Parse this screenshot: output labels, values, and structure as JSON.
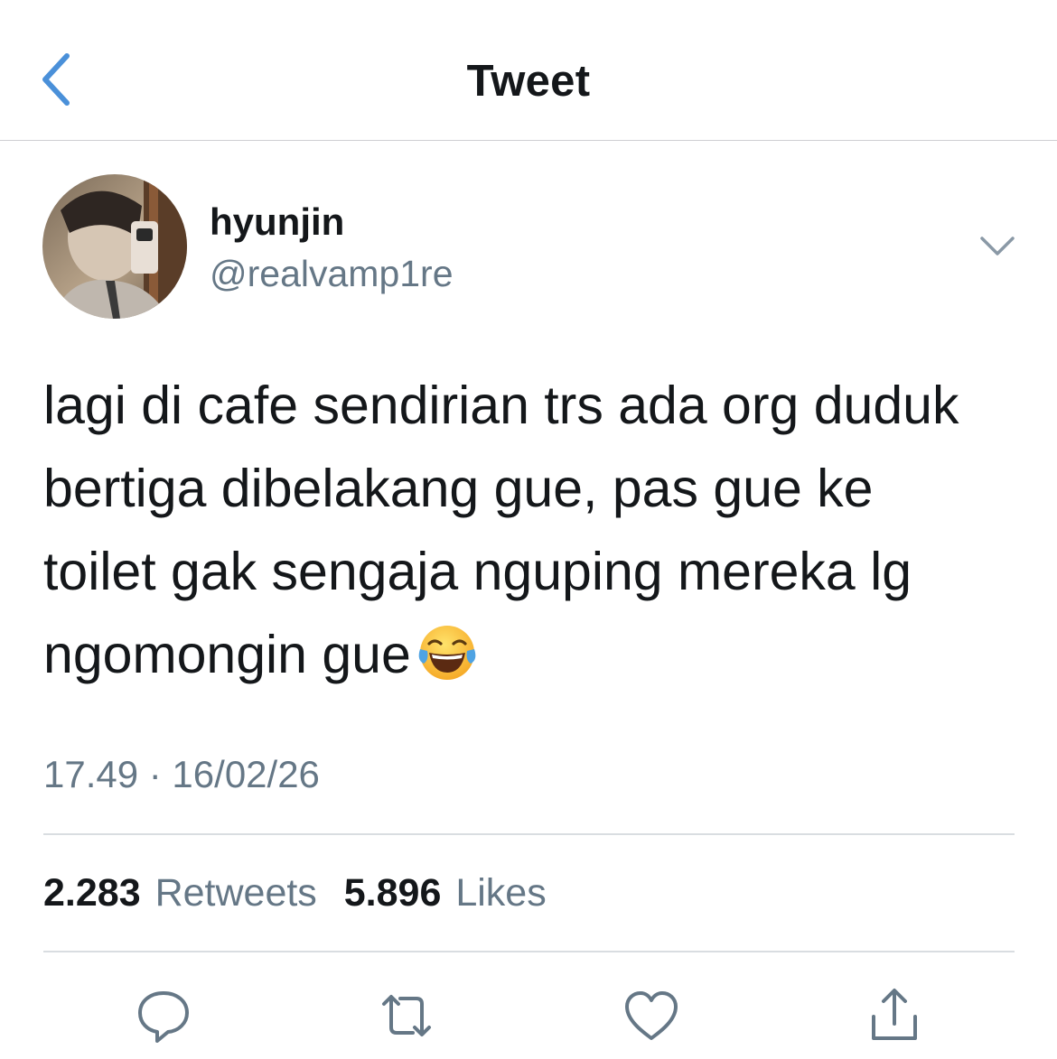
{
  "header": {
    "title": "Tweet",
    "back_icon": "chevron-left-icon"
  },
  "tweet": {
    "author": {
      "display_name": "hyunjin",
      "handle": "@realvamp1re"
    },
    "text": "lagi di cafe sendirian trs ada org duduk\nbertiga dibelakang gue, pas gue ke\ntoilet gak sengaja nguping mereka lg\nngomongin gue",
    "emoji": "face-with-tears-of-joy",
    "timestamp": "17.49 · 16/02/26"
  },
  "stats": {
    "retweets_count": "2.283",
    "retweets_label": "Retweets",
    "likes_count": "5.896",
    "likes_label": "Likes"
  },
  "actions": [
    "reply-icon",
    "retweet-icon",
    "like-icon",
    "share-icon"
  ],
  "colors": {
    "accent": "#4a90d9",
    "text": "#14171a",
    "secondary_text": "#657786",
    "divider": "#d9dde1",
    "action_icon": "#657786"
  }
}
